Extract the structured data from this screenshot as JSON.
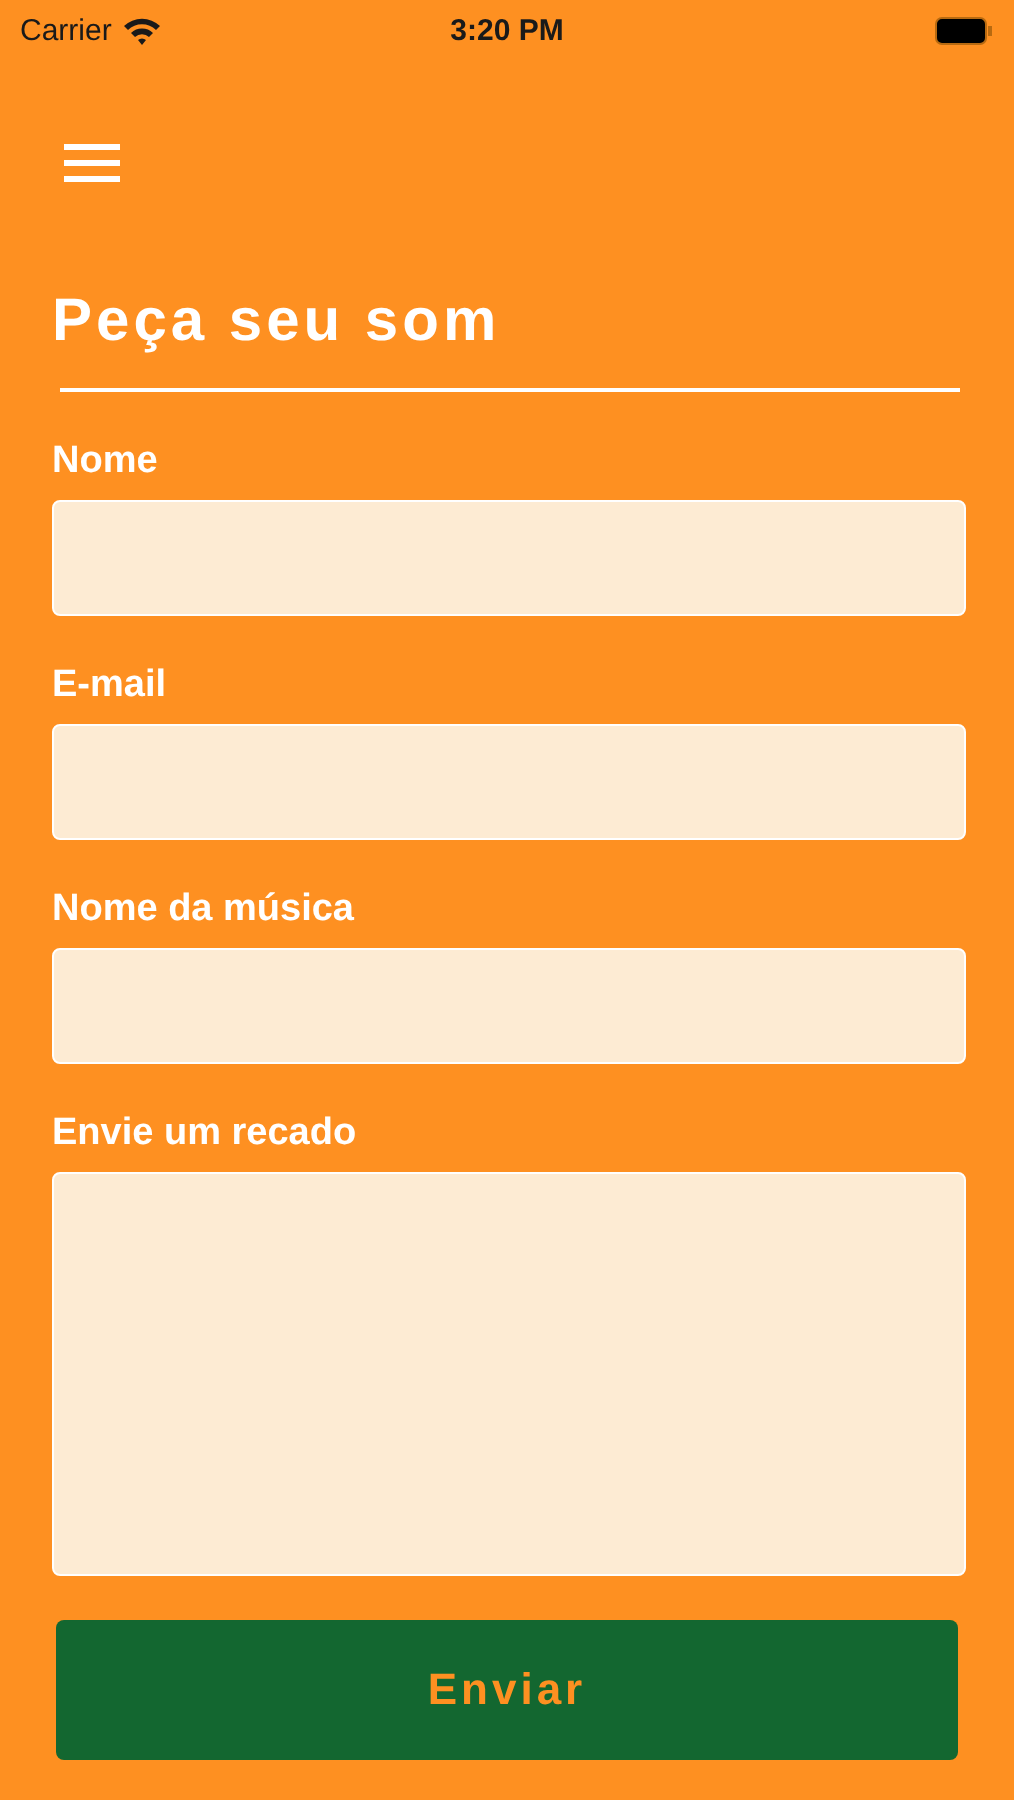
{
  "status_bar": {
    "carrier": "Carrier",
    "time": "3:20 PM"
  },
  "title": "Peça seu som",
  "fields": [
    {
      "label": "Nome",
      "kind": "line"
    },
    {
      "label": "E-mail",
      "kind": "line"
    },
    {
      "label": "Nome da música",
      "kind": "line"
    },
    {
      "label": "Envie um recado",
      "kind": "area"
    }
  ],
  "submit": "Enviar"
}
